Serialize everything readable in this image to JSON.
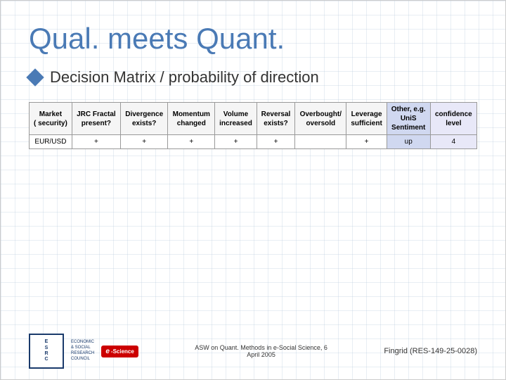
{
  "slide": {
    "title": "Qual. meets Quant.",
    "subtitle": "Decision Matrix / probability of direction",
    "table": {
      "headers_row1": [
        {
          "text": "Market\n( security)",
          "class": "col-market"
        },
        {
          "text": "JRC Fractal\npresent?",
          "class": "col-jrc"
        },
        {
          "text": "Divergence\nexists?",
          "class": "col-div"
        },
        {
          "text": "Momentum\nchanged",
          "class": "col-mom"
        },
        {
          "text": "Volume\nincreased",
          "class": "col-vol"
        },
        {
          "text": "Reversal\nexists?",
          "class": "col-rev"
        },
        {
          "text": "Overbought/\noversold",
          "class": "col-over"
        },
        {
          "text": "Leverage\nsufficient",
          "class": "col-lev"
        },
        {
          "text": "Other, e.g.\nUniS\nSentiment",
          "class": "col-other"
        },
        {
          "text": "confidence\nlevel",
          "class": "col-conf"
        }
      ],
      "rows": [
        {
          "cells": [
            "EUR/USD",
            "+",
            "+",
            "+",
            "+",
            "+",
            "",
            "+",
            "up",
            "4"
          ]
        }
      ]
    },
    "footer": {
      "left_esrc": "E\nS\nR\nC",
      "left_esrc_full": "ECONOMIC\n& SOCIAL\nRESEARCH\nCOUNCIL",
      "left_escience": "e-Science",
      "center_line1": "ASW on Quant. Methods in e-Social Science, 6",
      "center_line2": "April 2005",
      "right": "Fingrid (RES-149-25-0028)"
    }
  }
}
